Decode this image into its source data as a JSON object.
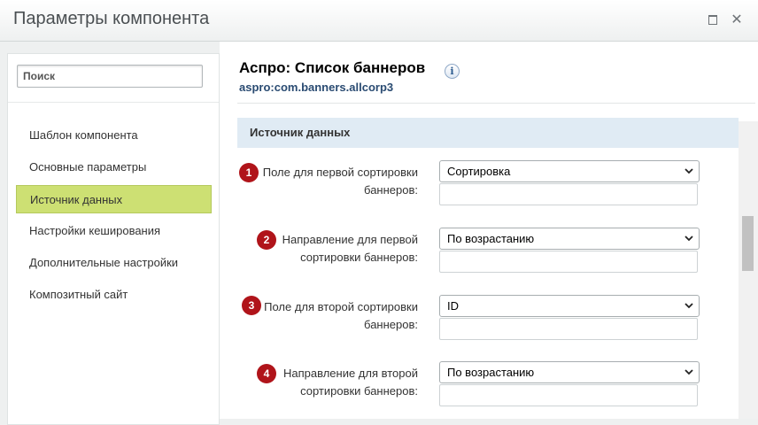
{
  "window": {
    "title": "Параметры компонента",
    "maximize_icon": "maximize-icon",
    "close_icon": "close-icon",
    "close_glyph": "✕"
  },
  "sidebar": {
    "search_placeholder": "Поиск",
    "items": [
      {
        "label": "Шаблон компонента",
        "active": false
      },
      {
        "label": "Основные параметры",
        "active": false
      },
      {
        "label": "Источник данных",
        "active": true
      },
      {
        "label": "Настройки кеширования",
        "active": false
      },
      {
        "label": "Дополнительные настройки",
        "active": false
      },
      {
        "label": "Композитный сайт",
        "active": false
      }
    ]
  },
  "component": {
    "title": "Аспро: Список баннеров",
    "info_glyph": "i",
    "code": "aspro:com.banners.allcorp3"
  },
  "section": {
    "label": "Источник данных"
  },
  "fields": [
    {
      "badge": "1",
      "label_line1": "Поле для первой сортировки",
      "label_line2": "баннеров:",
      "value": "Сортировка"
    },
    {
      "badge": "2",
      "label_line1": "Направление для первой",
      "label_line2": "сортировки баннеров:",
      "value": "По возрастанию"
    },
    {
      "badge": "3",
      "label_line1": "Поле для второй сортировки",
      "label_line2": "баннеров:",
      "value": "ID"
    },
    {
      "badge": "4",
      "label_line1": "Направление для второй",
      "label_line2": "сортировки баннеров:",
      "value": "По возрастанию"
    }
  ],
  "colors": {
    "active_nav": "#cde073",
    "badge": "#b0141a",
    "section_bg": "#e0ebf4",
    "code_text": "#2a4b72"
  }
}
